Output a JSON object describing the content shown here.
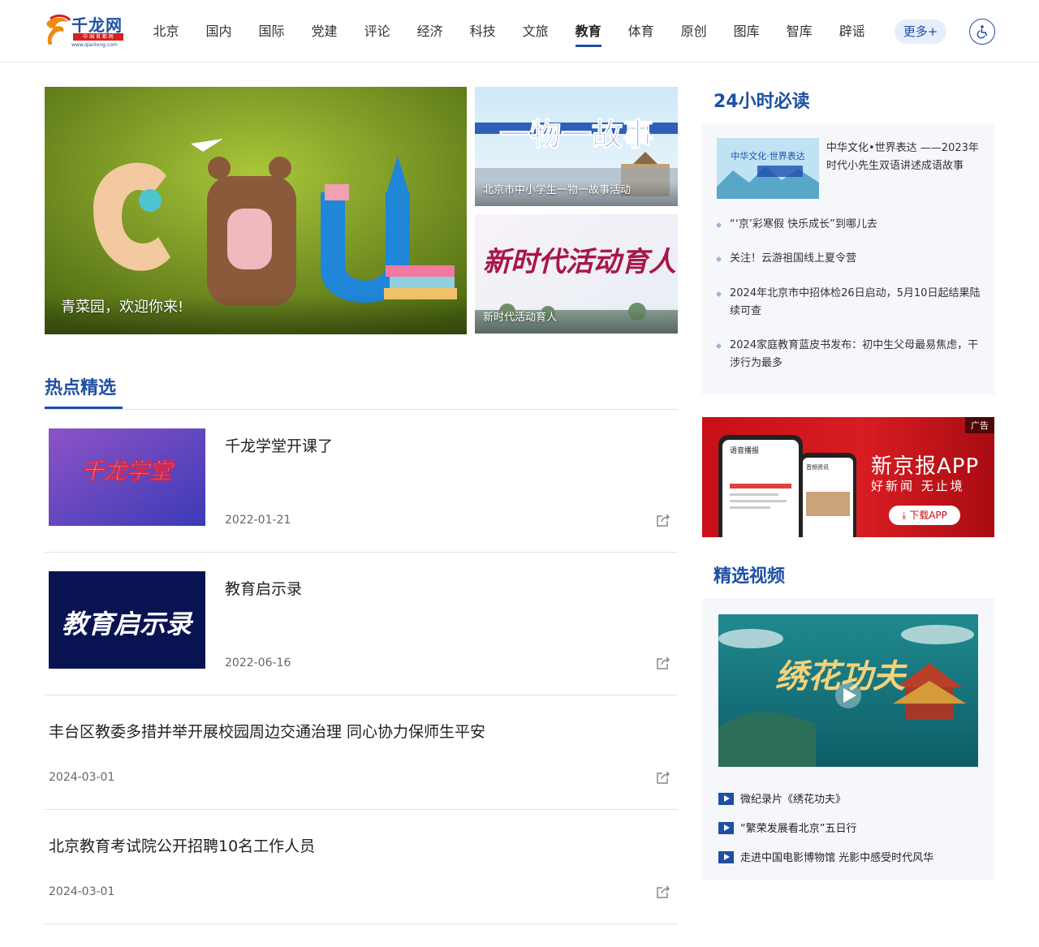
{
  "header": {
    "logo_text": "千龙网",
    "logo_sub": "中 国 首 都 网",
    "logo_url": "www.qianlong.com",
    "nav": [
      "北京",
      "国内",
      "国际",
      "党建",
      "评论",
      "经济",
      "科技",
      "文旅",
      "教育",
      "体育",
      "原创",
      "图库",
      "智库",
      "辟谣"
    ],
    "active_nav": "教育",
    "more_label": "更多+"
  },
  "hero": {
    "main_caption": "青菜园，欢迎你来!",
    "side1_banner": "一物一故事",
    "side1_caption": "北京市中小学生一物一故事活动",
    "side2_banner": "新时代活动育人",
    "side2_caption": "新时代活动育人"
  },
  "hot": {
    "title": "热点精选",
    "items": [
      {
        "title": "千龙学堂开课了",
        "date": "2022-01-21",
        "thumb_text": "千龙学堂"
      },
      {
        "title": "教育启示录",
        "date": "2022-06-16",
        "thumb_text": "教育启示录"
      },
      {
        "title": "丰台区教委多措并举开展校园周边交通治理 同心协力保师生平安",
        "date": "2024-03-01"
      },
      {
        "title": "北京教育考试院公开招聘10名工作人员",
        "date": "2024-03-01"
      }
    ]
  },
  "must_read": {
    "title": "24小时必读",
    "thumb_text": "中华文化·世界表达",
    "first": "中华文化•世界表达 ——2023年时代小先生双语讲述成语故事",
    "items": [
      "“‘京’彩寒假 快乐成长”到哪儿去",
      "关注！云游祖国线上夏令营",
      "2024年北京市中招体检26日启动，5月10日起结果陆续可查",
      "2024家庭教育蓝皮书发布：初中生父母最易焦虑，干涉行为最多"
    ]
  },
  "ad": {
    "tag": "广告",
    "title": "新京报APP",
    "subtitle": "好新闻  无止境",
    "button": "下载APP",
    "phone_label": "语音播报",
    "phone2_label": "音频资讯"
  },
  "video": {
    "title": "精选视频",
    "thumb_text": "绣花功夫",
    "items": [
      "微纪录片《绣花功夫》",
      "“繁荣发展看北京”五日行",
      "走进中国电影博物馆 光影中感受时代风华"
    ]
  },
  "colors": {
    "brand": "#1e4fa3",
    "ad_red": "#c80f17"
  }
}
